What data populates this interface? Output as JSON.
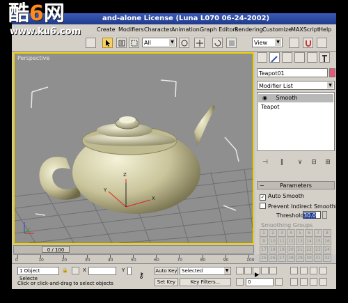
{
  "watermark": {
    "brand_left": "酷",
    "brand_six": "6",
    "brand_right": "网",
    "url": "www.ku6.com"
  },
  "window": {
    "title": "and-alone License (Luna L070 06-24-2002)"
  },
  "menu": [
    "Create",
    "Modifiers",
    "Character",
    "Animation",
    "Graph Editors",
    "Rendering",
    "Customize",
    "MAXScript",
    "Help"
  ],
  "toolbar": {
    "filter_select": "All",
    "coord_select": "View"
  },
  "viewport": {
    "label": "Perspective"
  },
  "command_panel": {
    "object_name": "Teapot01",
    "modifier_list": "Modifier List",
    "stack_items": [
      {
        "label": "Smooth",
        "selected": true
      },
      {
        "label": "Teapot",
        "selected": false
      }
    ],
    "rollout_title": "Parameters",
    "auto_smooth_label": "Auto Smooth",
    "auto_smooth_checked": true,
    "prevent_label": "Prevent Indirect Smoothing",
    "prevent_checked": false,
    "threshold_label": "Threshold:",
    "threshold_value": "30.0",
    "smoothing_groups_label": "Smoothing Groups",
    "smoothing_groups": [
      "1",
      "2",
      "3",
      "4",
      "5",
      "6",
      "7",
      "8",
      "9",
      "10",
      "11",
      "12",
      "13",
      "14",
      "15",
      "16",
      "17",
      "18",
      "19",
      "20",
      "21",
      "22",
      "23",
      "24",
      "25",
      "26",
      "27",
      "28",
      "29",
      "30",
      "31",
      "32"
    ]
  },
  "timeline": {
    "frame": "0 / 100",
    "ticks": [
      "0",
      "10",
      "20",
      "30",
      "40",
      "50",
      "60",
      "70",
      "80",
      "90",
      "100"
    ]
  },
  "status": {
    "selection": "1 Object Selecte",
    "prompt": "Click or click-and-drag to select objects",
    "x_label": "X",
    "y_label": "Y",
    "auto_key": "Auto Key",
    "set_key": "Set Key",
    "key_select": "Selected",
    "key_filters": "Key Filters...",
    "frame_field": "0"
  }
}
